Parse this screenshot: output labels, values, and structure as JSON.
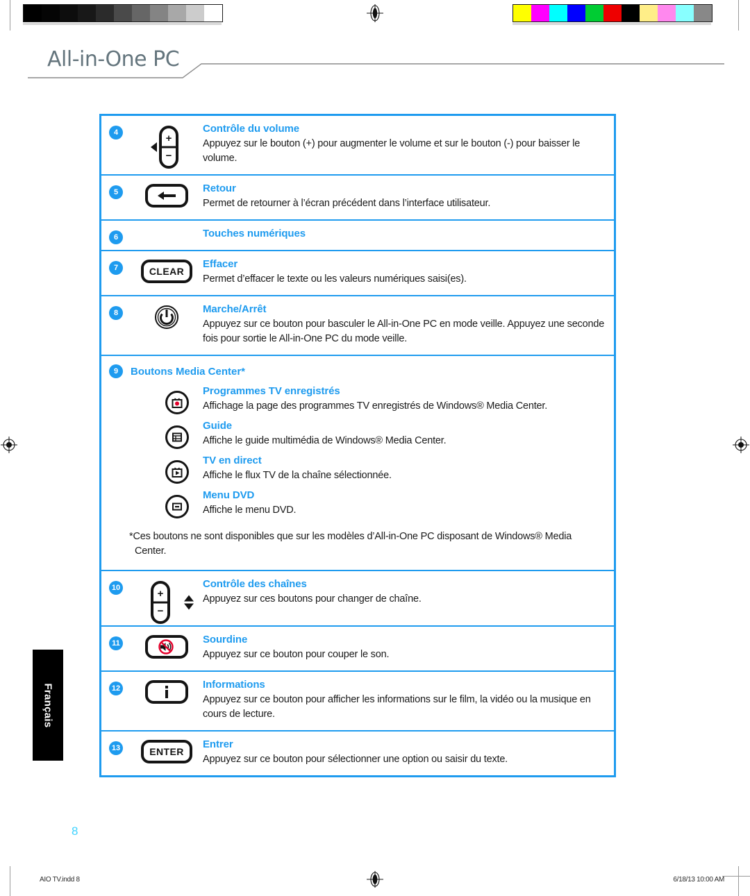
{
  "header": {
    "title": "All-in-One PC"
  },
  "language_tab": {
    "label": "Français"
  },
  "page_number": "8",
  "footer": {
    "file": "AIO TV.indd   8",
    "timestamp": "6/18/13   10:00 AM"
  },
  "colors": {
    "accent_blue": "#1e9bef",
    "header_gray": "#64757d",
    "page_number_blue": "#3fd3ff",
    "icon_black": "#141414",
    "mute_red": "#e3002b"
  },
  "color_bars": {
    "grayscale": [
      "#000000",
      "#050505",
      "#0d0d0d",
      "#181818",
      "#2b2b2b",
      "#4a4a4a",
      "#666666",
      "#848484",
      "#a8a8a8",
      "#cccccc",
      "#ffffff"
    ],
    "cmyk": [
      "#ffff00",
      "#ff00ff",
      "#00ffff",
      "#0000ff",
      "#00cc33",
      "#ee0000",
      "#000000",
      "#ffee88",
      "#ff88ee",
      "#88ffff",
      "#888888"
    ]
  },
  "table": {
    "rows": [
      {
        "number": "4",
        "icon": "volume-rocker-icon",
        "title": "Contrôle du volume",
        "description": "Appuyez sur le bouton (+) pour augmenter le volume et sur le bouton (-) pour baisser le volume."
      },
      {
        "number": "5",
        "icon": "back-arrow-button-icon",
        "title": "Retour",
        "description": "Permet de retourner à l’écran précédent dans l’interface utilisateur."
      },
      {
        "number": "6",
        "icon": "",
        "title": "Touches numériques",
        "description": ""
      },
      {
        "number": "7",
        "icon": "clear-button-icon",
        "icon_label": "CLEAR",
        "title": "Effacer",
        "description": "Permet d’effacer le texte ou les valeurs numériques saisi(es)."
      },
      {
        "number": "8",
        "icon": "power-button-icon",
        "title": "Marche/Arrêt",
        "description": "Appuyez sur ce bouton pour basculer le All-in-One PC en mode veille. Appuyez une seconde fois pour sortie le All-in-One PC du mode veille."
      }
    ],
    "media_center": {
      "number": "9",
      "title": "Boutons Media Center*",
      "items": [
        {
          "icon": "recorded-tv-icon",
          "title": "Programmes TV enregistrés",
          "description": "Affichage la page des programmes TV enregistrés de Windows® Media Center."
        },
        {
          "icon": "guide-icon",
          "title": "Guide",
          "description": "Affiche le guide multimédia de Windows® Media Center."
        },
        {
          "icon": "live-tv-icon",
          "title": "TV en direct",
          "description": "Affiche le flux TV de la chaîne sélectionnée."
        },
        {
          "icon": "dvd-menu-icon",
          "title": "Menu DVD",
          "description": "Affiche le menu DVD."
        }
      ],
      "footnote": "*Ces boutons ne sont disponibles que sur les modèles d’All-in-One PC disposant de Windows® Media Center."
    },
    "rows_bottom": [
      {
        "number": "10",
        "icon": "channel-rocker-icon",
        "title": "Contrôle des chaînes",
        "description": "Appuyez sur ces boutons pour changer de chaîne."
      },
      {
        "number": "11",
        "icon": "mute-button-icon",
        "title": "Sourdine",
        "description": "Appuyez sur ce bouton pour couper le son."
      },
      {
        "number": "12",
        "icon": "info-button-icon",
        "title": "Informations",
        "description": "Appuyez sur ce bouton pour afficher les informations sur le film, la vidéo ou la musique en cours de lecture."
      },
      {
        "number": "13",
        "icon": "enter-button-icon",
        "icon_label": "ENTER",
        "title": "Entrer",
        "description": "Appuyez sur ce bouton pour sélectionner une option ou saisir du texte."
      }
    ]
  }
}
